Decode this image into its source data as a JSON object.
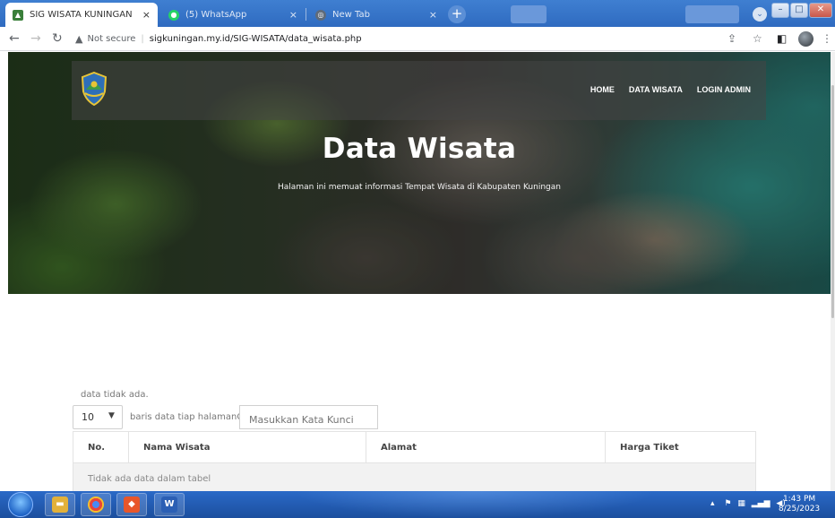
{
  "browser": {
    "tabs": [
      {
        "title": "SIG WISATA KUNINGAN",
        "active": true
      },
      {
        "title": "(5) WhatsApp",
        "active": false
      },
      {
        "title": "New Tab",
        "active": false
      }
    ],
    "new_tab_symbol": "+",
    "close_symbol": "×",
    "address": {
      "security_label": "Not secure",
      "url": "sigkuningan.my.id/SIG-WISATA/data_wisata.php"
    }
  },
  "site": {
    "nav": [
      {
        "label": "HOME"
      },
      {
        "label": "DATA WISATA"
      },
      {
        "label": "LOGIN ADMIN"
      }
    ],
    "hero": {
      "title": "Data Wisata",
      "subtitle": "Halaman ini memuat informasi Tempat Wisata di Kabupaten Kuningan"
    }
  },
  "table_controls": {
    "empty_note": "data tidak ada.",
    "page_size": "10",
    "rows_label": "baris data tiap halamanCari:",
    "search_placeholder": "Masukkan Kata Kunci"
  },
  "table": {
    "headers": [
      "No.",
      "Nama Wisata",
      "Alamat",
      "Harga Tiket"
    ],
    "empty_row": "Tidak ada data dalam tabel"
  },
  "taskbar": {
    "time": "1:43 PM",
    "date": "8/25/2023"
  },
  "colors": {
    "chrome_blue": "#2f6bc0",
    "taskbar_blue": "#1c4f9e"
  }
}
